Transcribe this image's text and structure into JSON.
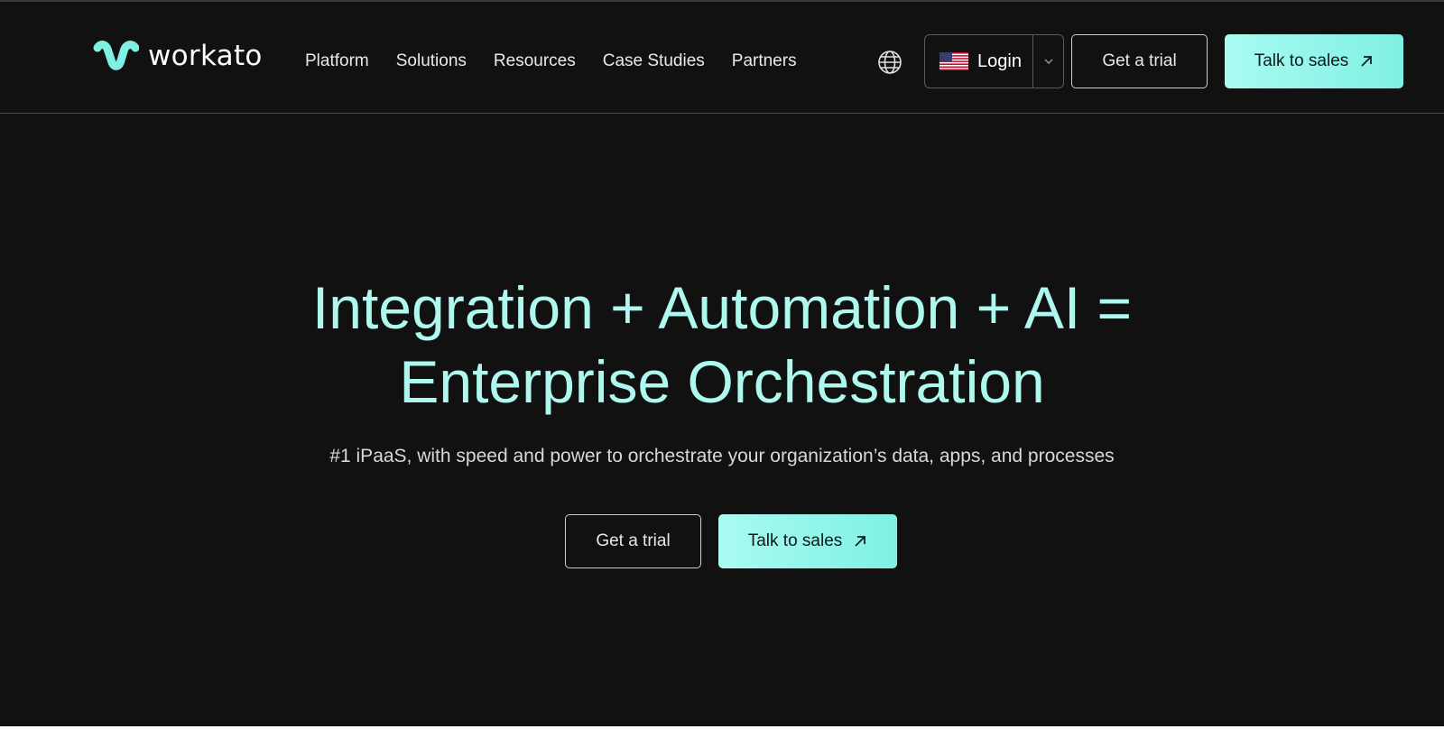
{
  "brand": {
    "name": "workato",
    "logo_icon": "workato-logo-icon",
    "accent": "#8ff5e8",
    "accent_light": "#aef8f0",
    "background": "#111111"
  },
  "nav": {
    "items": [
      {
        "label": "Platform"
      },
      {
        "label": "Solutions"
      },
      {
        "label": "Resources"
      },
      {
        "label": "Case Studies"
      },
      {
        "label": "Partners"
      }
    ]
  },
  "header": {
    "language_icon": "globe-icon",
    "login_label": "Login",
    "login_flag_icon": "us-flag-icon",
    "login_dropdown_icon": "chevron-down-icon",
    "trial_label": "Get a trial",
    "sales_label": "Talk to sales",
    "sales_icon": "arrow-up-right-icon"
  },
  "hero": {
    "title_line1": "Integration + Automation + AI =",
    "title_line2": "Enterprise Orchestration",
    "subtitle": "#1 iPaaS, with speed and power to orchestrate your organization’s data, apps, and processes",
    "trial_label": "Get a trial",
    "sales_label": "Talk to sales",
    "sales_icon": "arrow-up-right-icon"
  }
}
